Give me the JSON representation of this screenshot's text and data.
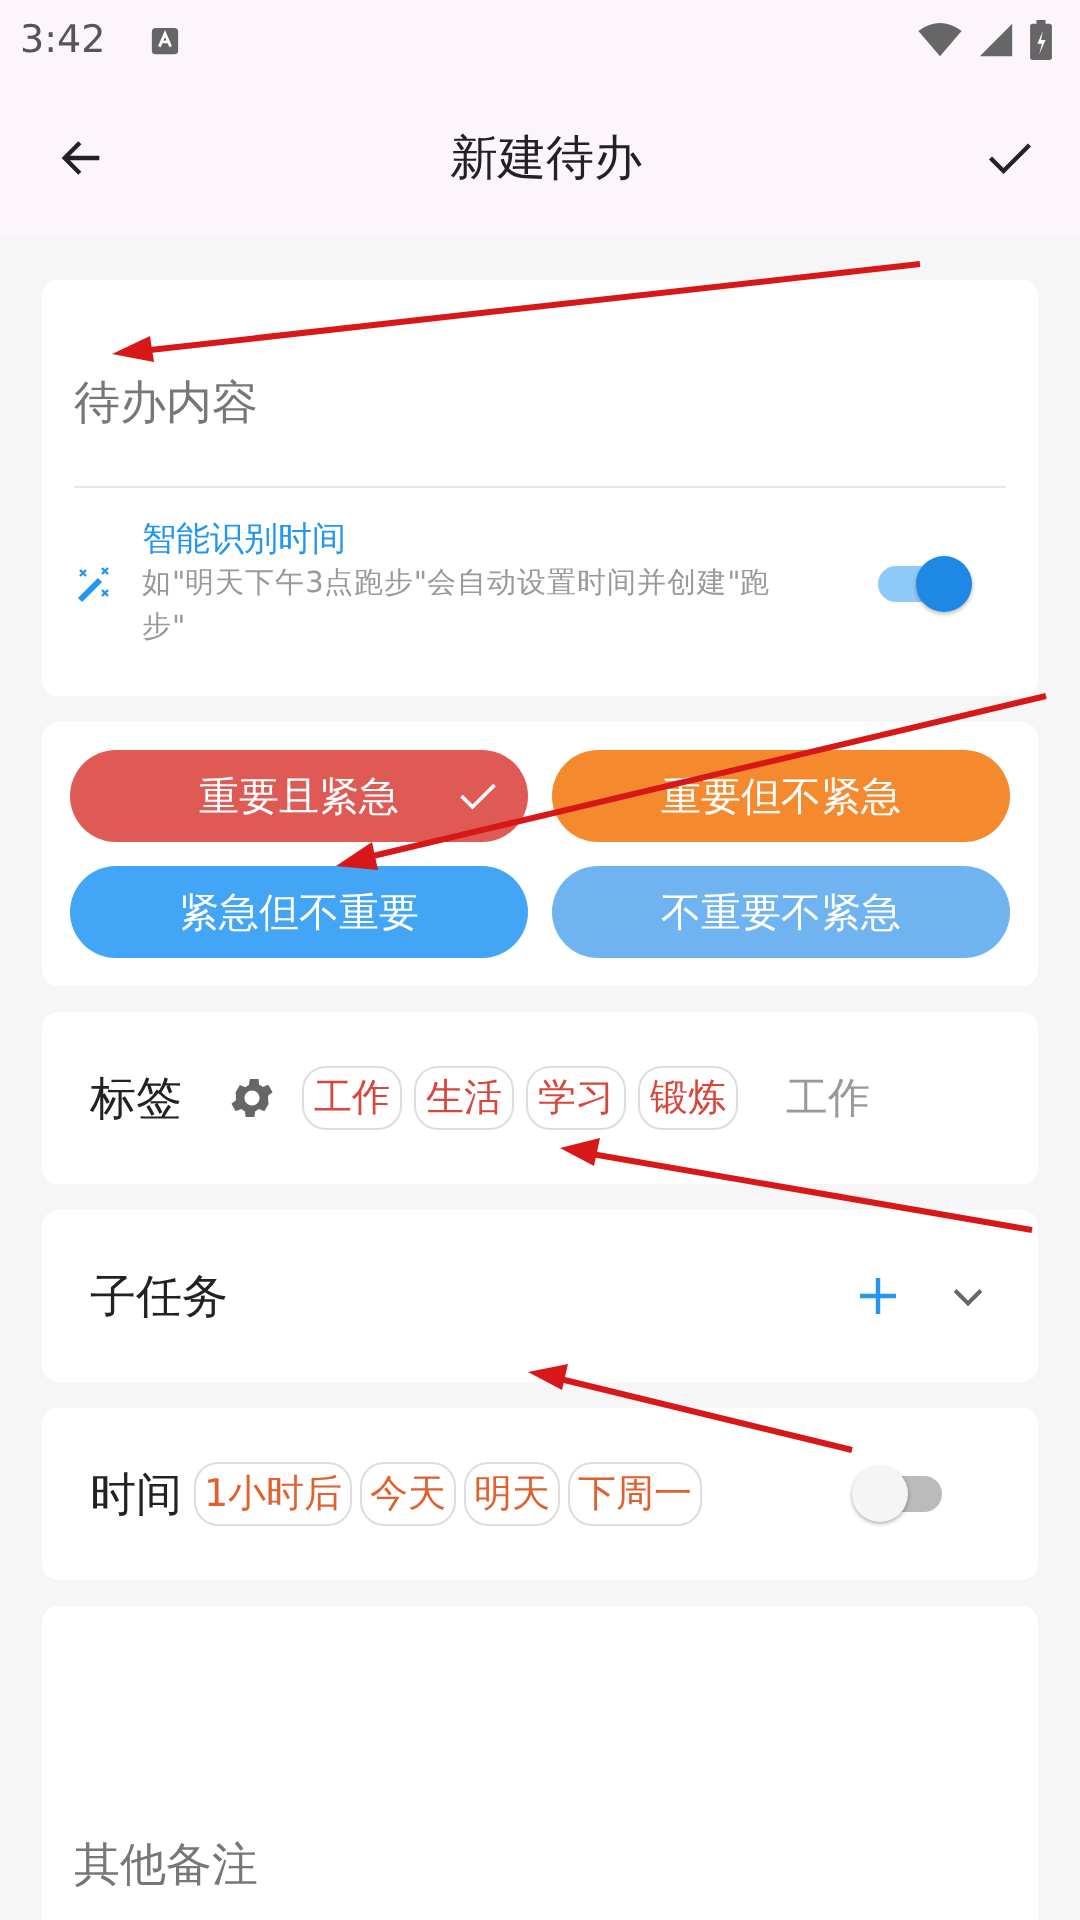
{
  "status_bar": {
    "time": "3:42"
  },
  "header": {
    "title": "新建待办"
  },
  "content": {
    "placeholder": "待办内容"
  },
  "smart_time": {
    "title": "智能识别时间",
    "description": "如\"明天下午3点跑步\"会自动设置时间并创建\"跑步\"",
    "on": true
  },
  "priorities": [
    {
      "label": "重要且紧急",
      "color": "#e05a55",
      "selected": true
    },
    {
      "label": "重要但不紧急",
      "color": "#f5892d",
      "selected": false
    },
    {
      "label": "紧急但不重要",
      "color": "#42a5f5",
      "selected": false
    },
    {
      "label": "不重要不紧急",
      "color": "#6fb3f0",
      "selected": false
    }
  ],
  "tags": {
    "label": "标签",
    "chips": [
      "工作",
      "生活",
      "学习",
      "锻炼"
    ],
    "current": "工作"
  },
  "subtasks": {
    "label": "子任务"
  },
  "time": {
    "label": "时间",
    "chips": [
      "1小时后",
      "今天",
      "明天",
      "下周一"
    ],
    "on": false
  },
  "notes": {
    "placeholder": "其他备注"
  }
}
